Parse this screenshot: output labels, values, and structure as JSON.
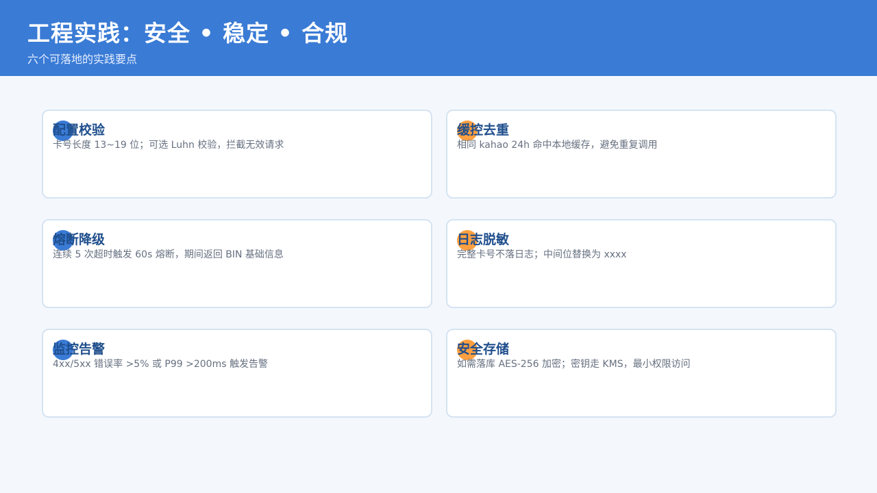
{
  "header": {
    "title": "工程实践：安全 • 稳定 • 合规",
    "subtitle": "六个可落地的实践要点"
  },
  "colors": {
    "header_bg": "#3a7bd5",
    "dot_blue": "#3a7bd5",
    "dot_orange": "#ffa040",
    "card_title": "#1f4e8c"
  },
  "cards": [
    {
      "title": "配置校验",
      "desc": "卡号长度 13~19 位；可选 Luhn 校验，拦截无效请求",
      "dot_color": "blue"
    },
    {
      "title": "缓控去重",
      "desc": "相同 kahao 24h 命中本地缓存，避免重复调用",
      "dot_color": "orange"
    },
    {
      "title": "熔断降级",
      "desc": "连续 5 次超时触发 60s 熔断，期间返回 BIN 基础信息",
      "dot_color": "blue"
    },
    {
      "title": "日志脱敏",
      "desc": "完整卡号不落日志；中间位替换为 xxxx",
      "dot_color": "orange"
    },
    {
      "title": "监控告警",
      "desc": "4xx/5xx 错误率 >5% 或 P99 >200ms 触发告警",
      "dot_color": "blue"
    },
    {
      "title": "安全存储",
      "desc": "如需落库 AES-256 加密；密钥走 KMS，最小权限访问",
      "dot_color": "orange"
    }
  ]
}
